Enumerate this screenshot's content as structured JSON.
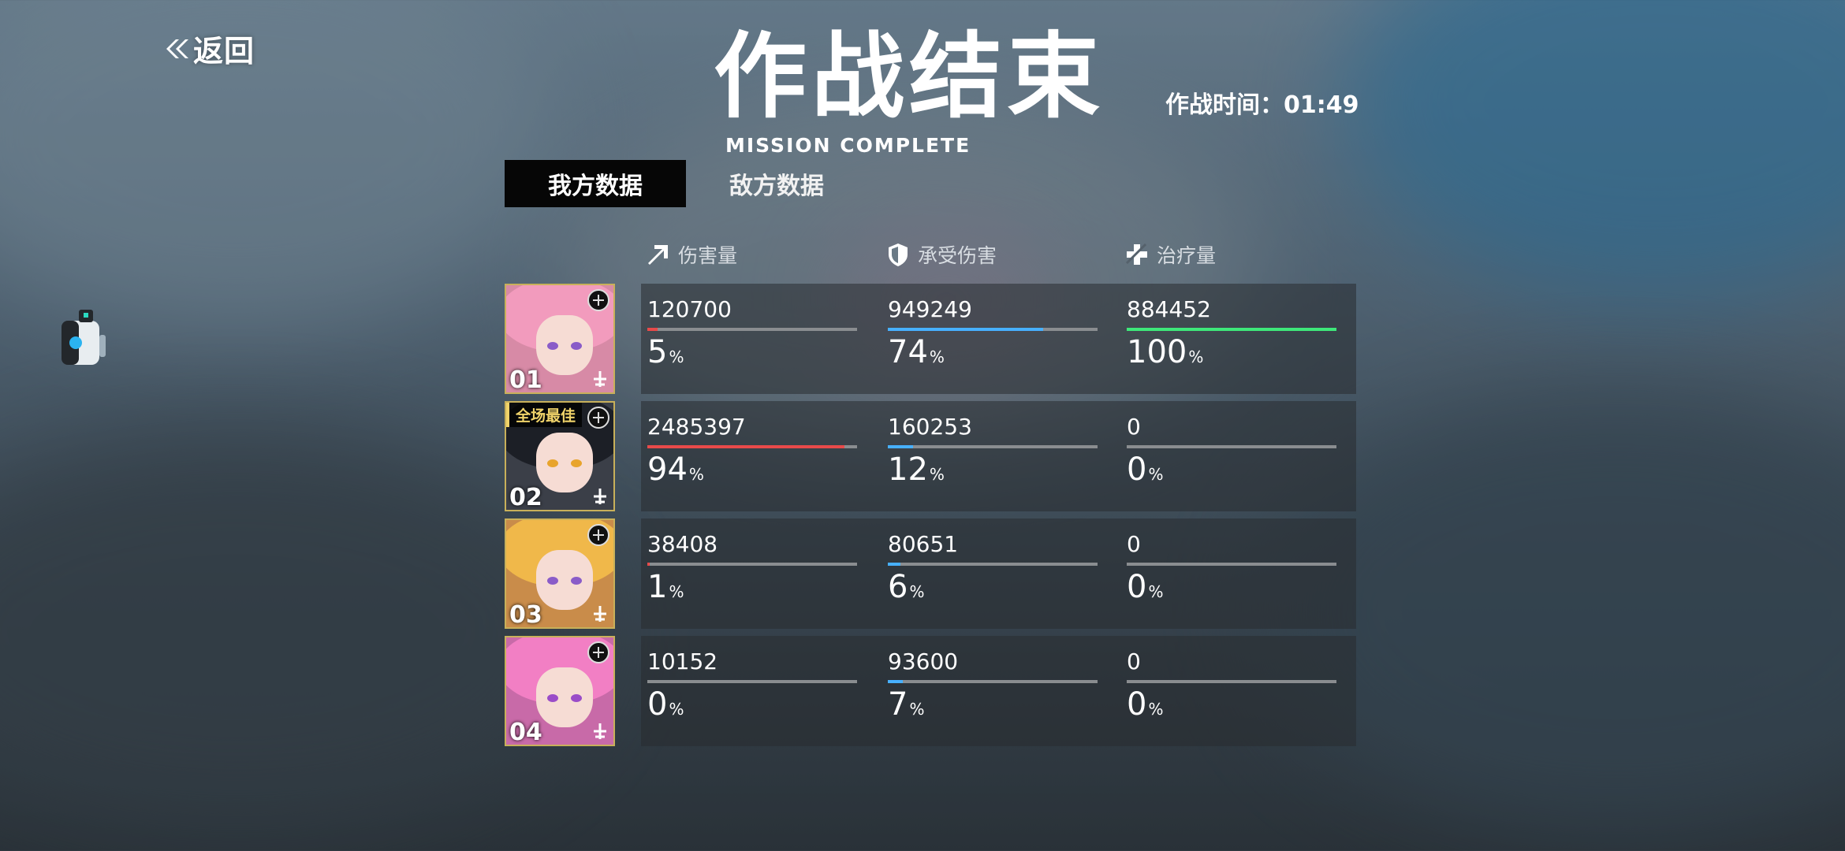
{
  "back_label": "返回",
  "title": "作战结束",
  "subtitle": "MISSION COMPLETE",
  "timer": "作战时间：01:49",
  "tabs": [
    "我方数据",
    "敌方数据"
  ],
  "columns": [
    {
      "label": "伤害量",
      "icon": "arrow-up-right-icon",
      "color": "#e84a4a"
    },
    {
      "label": "承受伤害",
      "icon": "shield-icon",
      "color": "#47b0ff"
    },
    {
      "label": "治疗量",
      "icon": "heal-cross-icon",
      "color": "#3ee87a"
    }
  ],
  "units": [
    {
      "num": "01",
      "badge": "",
      "damage": "120700",
      "damage_pct": 5,
      "taken": "949249",
      "taken_pct": 74,
      "heal": "884452",
      "heal_pct": 100
    },
    {
      "num": "02",
      "badge": "全场最佳",
      "damage": "2485397",
      "damage_pct": 94,
      "taken": "160253",
      "taken_pct": 12,
      "heal": "0",
      "heal_pct": 0
    },
    {
      "num": "03",
      "badge": "",
      "damage": "38408",
      "damage_pct": 1,
      "taken": "80651",
      "taken_pct": 6,
      "heal": "0",
      "heal_pct": 0
    },
    {
      "num": "04",
      "badge": "",
      "damage": "10152",
      "damage_pct": 0,
      "taken": "93600",
      "taken_pct": 7,
      "heal": "0",
      "heal_pct": 0
    }
  ],
  "pct_unit": "%"
}
